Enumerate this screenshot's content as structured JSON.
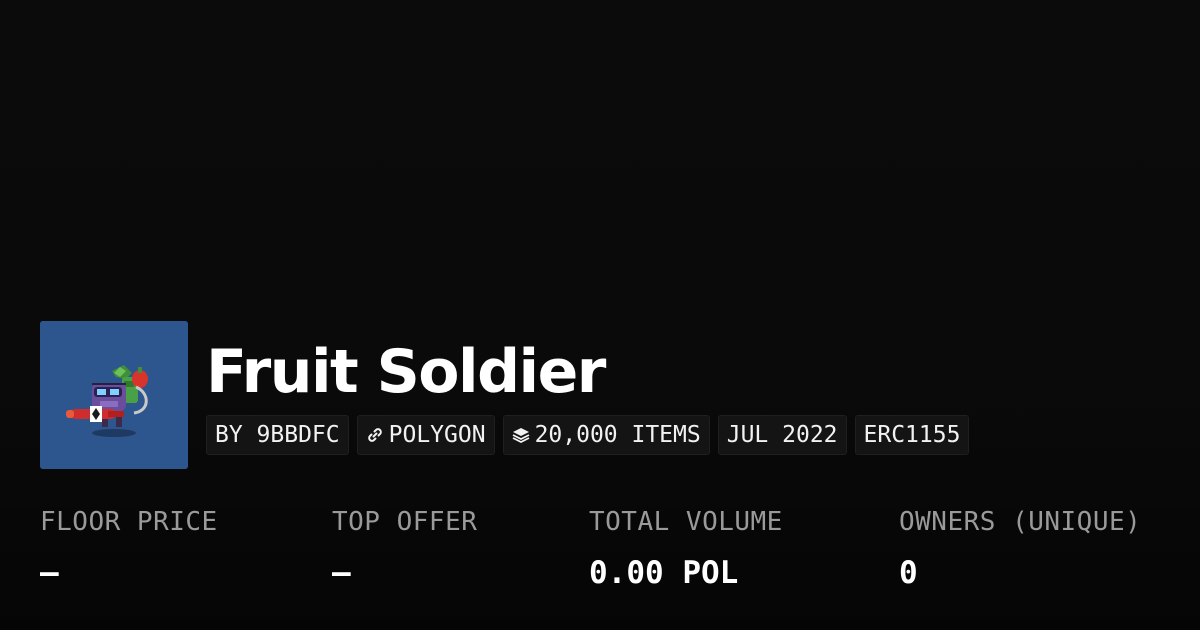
{
  "collection": {
    "name": "Fruit Soldier",
    "tags": [
      {
        "label": "BY 9BBDFC",
        "icon": null
      },
      {
        "label": "POLYGON",
        "icon": "chain-link-icon"
      },
      {
        "label": "20,000 ITEMS",
        "icon": "layers-icon"
      },
      {
        "label": "JUL 2022",
        "icon": null
      },
      {
        "label": "ERC1155",
        "icon": null
      }
    ],
    "avatar_background": "#2d558e"
  },
  "stats": [
    {
      "label": "FLOOR PRICE",
      "value": "–"
    },
    {
      "label": "TOP OFFER",
      "value": "–"
    },
    {
      "label": "TOTAL VOLUME",
      "value": "0.00 POL"
    },
    {
      "label": "OWNERS (UNIQUE)",
      "value": "0"
    }
  ],
  "colors": {
    "background": "#0a0a0a",
    "text": "#ffffff",
    "muted_label": "#9a9a9a",
    "tag_background": "#141414"
  }
}
